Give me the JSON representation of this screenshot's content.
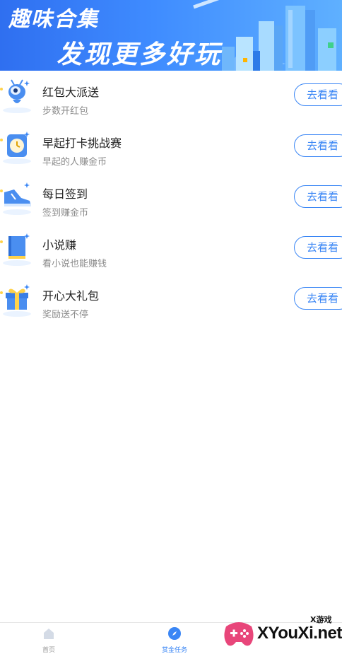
{
  "banner": {
    "title": "趣味合集",
    "subtitle": "发现更多好玩"
  },
  "tasks": [
    {
      "title": "红包大派送",
      "desc": "步数开红包",
      "button": "去看看",
      "icon": "robot-mascot-icon"
    },
    {
      "title": "早起打卡挑战赛",
      "desc": "早起的人赚金币",
      "button": "去看看",
      "icon": "clock-icon"
    },
    {
      "title": "每日签到",
      "desc": "签到赚金币",
      "button": "去看看",
      "icon": "sneaker-icon"
    },
    {
      "title": "小说赚",
      "desc": "看小说也能赚钱",
      "button": "去看看",
      "icon": "book-icon"
    },
    {
      "title": "开心大礼包",
      "desc": "奖励送不停",
      "button": "去看看",
      "icon": "gift-box-icon"
    }
  ],
  "bottom_nav": {
    "items": [
      {
        "label": "首页",
        "icon": "home-icon",
        "active": false
      },
      {
        "label": "赏金任务",
        "icon": "compass-icon",
        "active": true
      }
    ]
  },
  "watermark": {
    "small": "X游戏",
    "text": "XYouXi.net"
  },
  "colors": {
    "accent": "#3a86f5",
    "banner_blue": "#3f8cff"
  }
}
